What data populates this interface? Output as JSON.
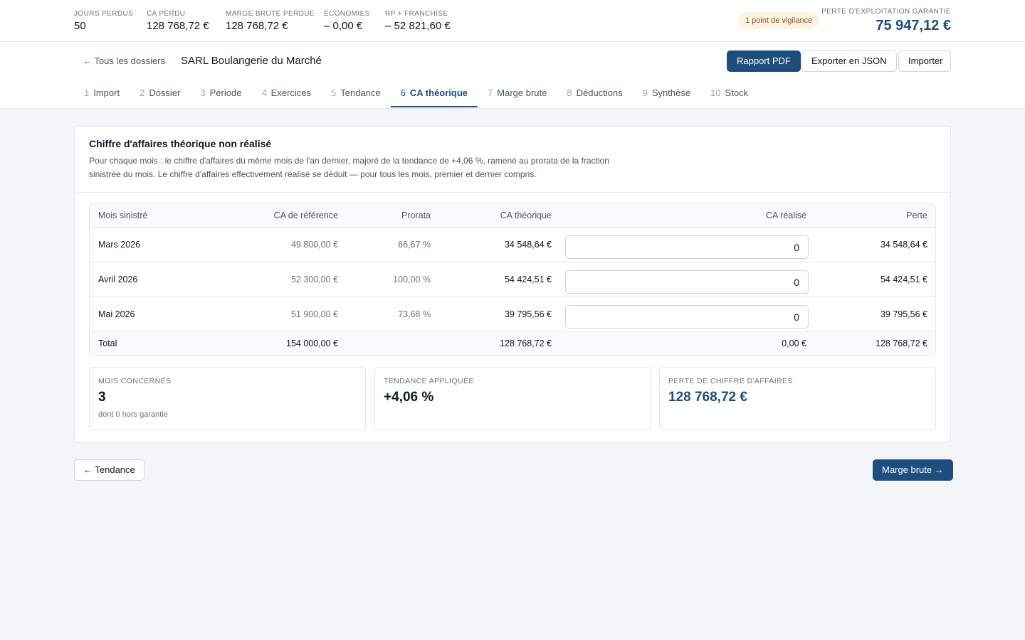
{
  "kpis": [
    {
      "label": "JOURS PERDUS",
      "value": "50"
    },
    {
      "label": "CA PERDU",
      "value": "128 768,72 €"
    },
    {
      "label": "MARGE BRUTE PERDUE",
      "value": "128 768,72 €"
    },
    {
      "label": "ÉCONOMIES",
      "value": "– 0,00 €"
    },
    {
      "label": "RP + FRANCHISE",
      "value": "– 52 821,60 €"
    }
  ],
  "vigilance": "1 point de vigilance",
  "total_kpi": {
    "label": "PERTE D'EXPLOITATION GARANTIE",
    "value": "75 947,12 €"
  },
  "header": {
    "back_label": "← Tous les dossiers",
    "dossier_title": "SARL Boulangerie du Marché",
    "buttons": {
      "pdf": "Rapport PDF",
      "json": "Exporter en JSON",
      "import": "Importer"
    }
  },
  "tabs": [
    {
      "num": "1",
      "label": "Import"
    },
    {
      "num": "2",
      "label": "Dossier"
    },
    {
      "num": "3",
      "label": "Période"
    },
    {
      "num": "4",
      "label": "Exercices"
    },
    {
      "num": "5",
      "label": "Tendance"
    },
    {
      "num": "6",
      "label": "CA théorique"
    },
    {
      "num": "7",
      "label": "Marge brute"
    },
    {
      "num": "8",
      "label": "Déductions"
    },
    {
      "num": "9",
      "label": "Synthèse"
    },
    {
      "num": "10",
      "label": "Stock"
    }
  ],
  "active_tab": "6",
  "card": {
    "title": "Chiffre d'affaires théorique non réalisé",
    "description": "Pour chaque mois : le chiffre d'affaires du même mois de l'an dernier, majoré de la tendance de +4,06 %, ramené au prorata de la fraction sinistrée du mois. Le chiffre d'affaires effectivement réalisé se déduit — pour tous les mois, premier et dernier compris."
  },
  "table": {
    "headers": {
      "month": "Mois sinistré",
      "ref": "CA de référence",
      "prorata": "Prorata",
      "theorique": "CA théorique",
      "realise": "CA réalisé",
      "perte": "Perte"
    },
    "rows": [
      {
        "month": "Mars 2026",
        "ref": "49 800,00 €",
        "prorata": "66,67 %",
        "theorique": "34 548,64 €",
        "realise": "0",
        "perte": "34 548,64 €"
      },
      {
        "month": "Avril 2026",
        "ref": "52 300,00 €",
        "prorata": "100,00 %",
        "theorique": "54 424,51 €",
        "realise": "0",
        "perte": "54 424,51 €"
      },
      {
        "month": "Mai 2026",
        "ref": "51 900,00 €",
        "prorata": "73,68 %",
        "theorique": "39 795,56 €",
        "realise": "0",
        "perte": "39 795,56 €"
      }
    ],
    "total": {
      "label": "Total",
      "ref": "154 000,00 €",
      "theorique": "128 768,72 €",
      "realise": "0,00 €",
      "perte": "128 768,72 €"
    }
  },
  "stats": [
    {
      "label": "MOIS CONCERNÉS",
      "value": "3",
      "sub": "dont 0 hors garantie"
    },
    {
      "label": "TENDANCE APPLIQUÉE",
      "value": "+4,06 %"
    },
    {
      "label": "PERTE DE CHIFFRE D'AFFAIRES",
      "value": "128 768,72 €"
    }
  ],
  "nav": {
    "prev": "← Tendance",
    "next": "Marge brute →"
  },
  "colors": {
    "accent": "#1d4e7e",
    "vigilance_bg": "#fdf3e3",
    "vigilance_text": "#92541b"
  }
}
